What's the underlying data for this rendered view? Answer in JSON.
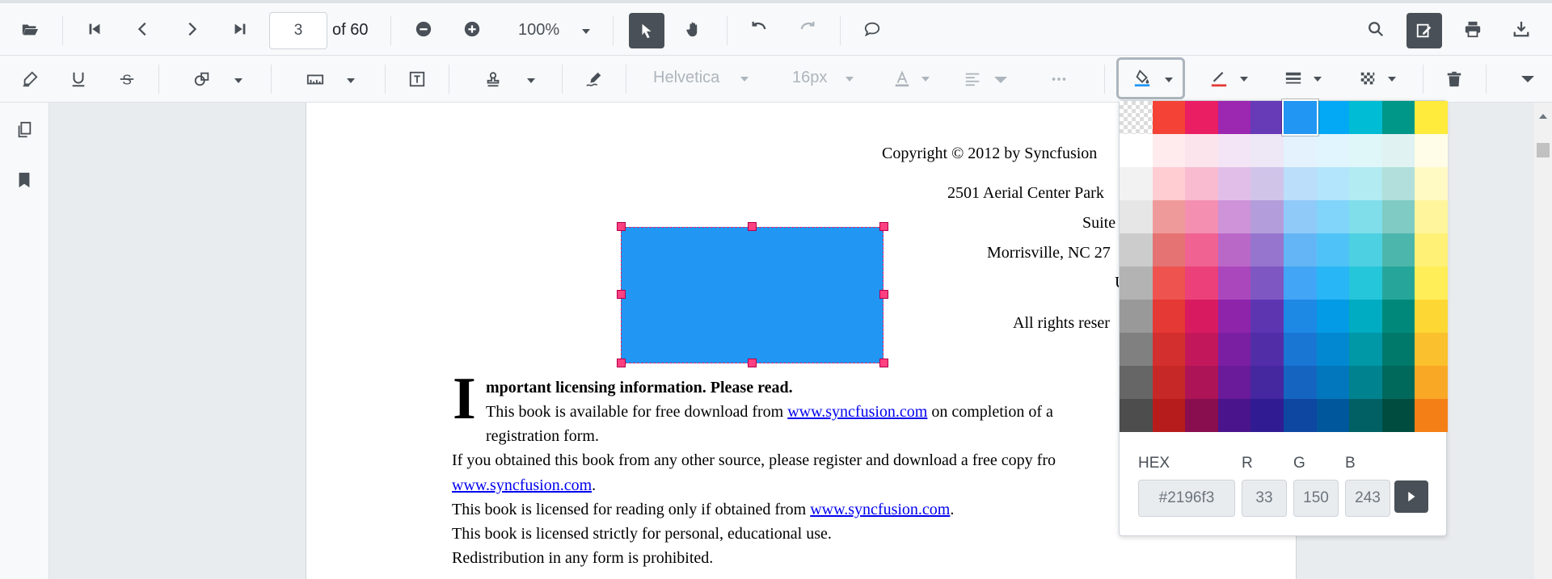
{
  "toolbar": {
    "page_number": "3",
    "page_of": "of 60",
    "zoom": "100%",
    "icons": [
      "open-file-icon",
      "first-page-icon",
      "previous-page-icon",
      "next-page-icon",
      "last-page-icon",
      "zoom-out-icon",
      "zoom-in-icon",
      "select-tool-icon",
      "pan-tool-icon",
      "undo-icon",
      "redo-icon",
      "comment-icon",
      "search-icon",
      "edit-annotation-icon",
      "print-icon",
      "download-icon"
    ]
  },
  "annotation_toolbar": {
    "font_family": "Helvetica",
    "font_size": "16px",
    "icons": [
      "highlight-icon",
      "underline-icon",
      "strikethrough-icon",
      "shapes-icon",
      "measure-icon",
      "free-text-icon",
      "stamp-icon",
      "signature-icon",
      "font-color-icon",
      "text-align-icon",
      "more-options-icon",
      "fill-color-icon",
      "stroke-color-icon",
      "line-thickness-icon",
      "opacity-icon",
      "delete-icon"
    ]
  },
  "sidebar": {
    "icons": [
      "page-thumbnails-icon",
      "bookmarks-icon"
    ]
  },
  "document": {
    "address": [
      "Copyright © 2012 by Syncfusion",
      "2501 Aerial Center Park",
      "Suite",
      "Morrisville, NC 27",
      "U",
      "All rights reser"
    ],
    "drop_cap": "I",
    "heading": "mportant licensing information. Please read.",
    "line1_a": "This book is available for free download from ",
    "line1_link": "www.syncfusion.com",
    "line1_b": " on completion of a",
    "line2": "registration form.",
    "line3": "If you obtained this book from any other source, please register and download a free copy fro",
    "line4_link": "www.syncfusion.com",
    "line4_b": ".",
    "line5_a": "This book is licensed for reading only if obtained from ",
    "line5_link": "www.syncfusion.com",
    "line5_b": ".",
    "line6": "This book is licensed strictly for personal, educational use.",
    "line7": "Redistribution in any form is prohibited."
  },
  "color_picker": {
    "hex_label": "HEX",
    "r_label": "R",
    "g_label": "G",
    "b_label": "B",
    "hex_value": "#2196f3",
    "r_value": "33",
    "g_value": "150",
    "b_value": "243",
    "selected_color": "#2196f3",
    "palette": [
      [
        "transparent",
        "#f44336",
        "#e91e63",
        "#9c27b0",
        "#673ab7",
        "#2196f3",
        "#03a9f4",
        "#00bcd4",
        "#009688",
        "#ffeb3b"
      ],
      [
        "#ffffff",
        "#ffebee",
        "#fce4ec",
        "#f3e5f5",
        "#ede7f6",
        "#e3f2fd",
        "#e1f5fe",
        "#e0f7fa",
        "#e0f2f1",
        "#fffde7"
      ],
      [
        "#f2f2f2",
        "#ffcdd2",
        "#f8bbd0",
        "#e1bee7",
        "#d1c4e9",
        "#bbdefb",
        "#b3e5fc",
        "#b2ebf2",
        "#b2dfdb",
        "#fff9c4"
      ],
      [
        "#e6e6e6",
        "#ef9a9a",
        "#f48fb1",
        "#ce93d8",
        "#b39ddb",
        "#90caf9",
        "#81d4fa",
        "#80deea",
        "#80cbc4",
        "#fff59d"
      ],
      [
        "#cccccc",
        "#e57373",
        "#f06292",
        "#ba68c8",
        "#9575cd",
        "#64b5f6",
        "#4fc3f7",
        "#4dd0e1",
        "#4db6ac",
        "#fff176"
      ],
      [
        "#b3b3b3",
        "#ef5350",
        "#ec407a",
        "#ab47bc",
        "#7e57c2",
        "#42a5f5",
        "#29b6f6",
        "#26c6da",
        "#26a69a",
        "#ffee58"
      ],
      [
        "#999999",
        "#e53935",
        "#d81b60",
        "#8e24aa",
        "#5e35b1",
        "#1e88e5",
        "#039be5",
        "#00acc1",
        "#00897b",
        "#fdd835"
      ],
      [
        "#808080",
        "#d32f2f",
        "#c2185b",
        "#7b1fa2",
        "#512da8",
        "#1976d2",
        "#0288d1",
        "#0097a7",
        "#00796b",
        "#fbc02d"
      ],
      [
        "#666666",
        "#c62828",
        "#ad1457",
        "#6a1b9a",
        "#4527a0",
        "#1565c0",
        "#0277bd",
        "#00838f",
        "#00695c",
        "#f9a825"
      ],
      [
        "#4d4d4d",
        "#b71c1c",
        "#880e4f",
        "#4a148c",
        "#311b92",
        "#0d47a1",
        "#01579b",
        "#006064",
        "#004d40",
        "#f57f17"
      ]
    ]
  },
  "colors": {
    "annotation_fill": "#2196f3",
    "annotation_handles": "#ff4081",
    "stroke_color_indicator": "#e53935",
    "active_button": "#495057"
  }
}
